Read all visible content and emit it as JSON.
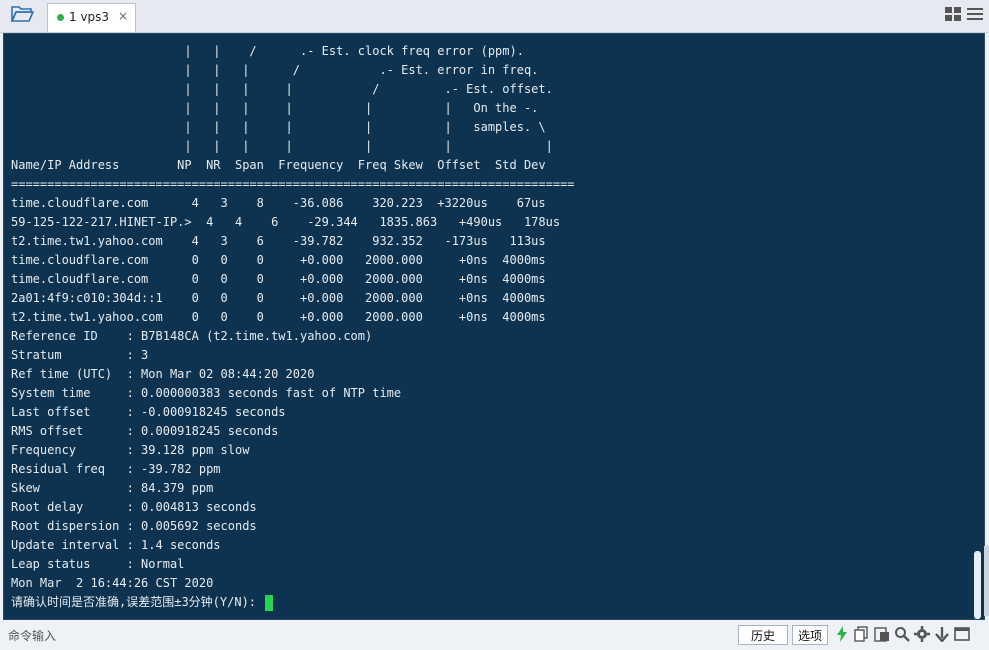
{
  "tab": {
    "label": "1 vps3",
    "close": "×"
  },
  "terminal": {
    "lines": [
      "                        |   |    /      .- Est. clock freq error (ppm).",
      "                        |   |   |      /           .- Est. error in freq.",
      "                        |   |   |     |           /         .- Est. offset.",
      "                        |   |   |     |          |          |   On the -.",
      "                        |   |   |     |          |          |   samples. \\",
      "                        |   |   |     |          |          |             |",
      "Name/IP Address        NP  NR  Span  Frequency  Freq Skew  Offset  Std Dev",
      "==============================================================================",
      "time.cloudflare.com      4   3    8    -36.086    320.223  +3220us    67us",
      "59-125-122-217.HINET-IP.>  4   4    6    -29.344   1835.863   +490us   178us",
      "t2.time.tw1.yahoo.com    4   3    6    -39.782    932.352   -173us   113us",
      "time.cloudflare.com      0   0    0     +0.000   2000.000     +0ns  4000ms",
      "time.cloudflare.com      0   0    0     +0.000   2000.000     +0ns  4000ms",
      "2a01:4f9:c010:304d::1    0   0    0     +0.000   2000.000     +0ns  4000ms",
      "t2.time.tw1.yahoo.com    0   0    0     +0.000   2000.000     +0ns  4000ms",
      "Reference ID    : B7B148CA (t2.time.tw1.yahoo.com)",
      "Stratum         : 3",
      "Ref time (UTC)  : Mon Mar 02 08:44:20 2020",
      "System time     : 0.000000383 seconds fast of NTP time",
      "Last offset     : -0.000918245 seconds",
      "RMS offset      : 0.000918245 seconds",
      "Frequency       : 39.128 ppm slow",
      "Residual freq   : -39.782 ppm",
      "Skew            : 84.379 ppm",
      "Root delay      : 0.004813 seconds",
      "Root dispersion : 0.005692 seconds",
      "Update interval : 1.4 seconds",
      "Leap status     : Normal",
      "Mon Mar  2 16:44:26 CST 2020"
    ],
    "prompt": "请确认时间是否准确,误差范围±3分钟(Y/N): "
  },
  "bottom": {
    "placeholder": "命令输入",
    "history_label": "历史",
    "select_label": "选项"
  },
  "colors": {
    "terminal_bg": "#0d3350",
    "terminal_fg": "#e6ecf1",
    "cursor": "#27d451",
    "status_dot": "#2bb24c",
    "folder": "#2f6fb3"
  },
  "icons": [
    "folder-open-icon",
    "layout-grid-icon",
    "menu-icon",
    "lightning-icon",
    "copy-icon",
    "paste-icon",
    "search-icon",
    "gear-icon",
    "arrow-down-icon",
    "window-icon"
  ]
}
